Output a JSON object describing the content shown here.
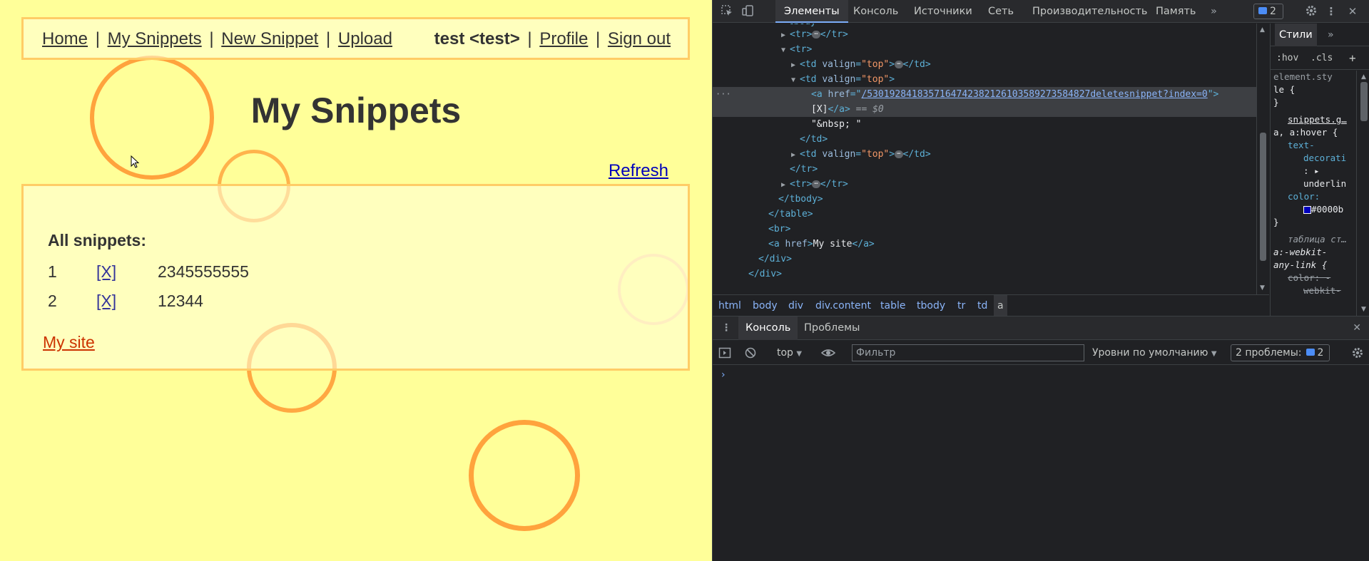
{
  "nav": {
    "home": "Home",
    "my_snippets": "My Snippets",
    "new_snippet": "New Snippet",
    "upload": "Upload",
    "separator": "|",
    "user": "test <test>",
    "profile": "Profile",
    "sign_out": "Sign out"
  },
  "page": {
    "title": "My Snippets",
    "refresh": "Refresh",
    "all_snippets": "All snippets:",
    "my_site": "My site",
    "snippets": [
      {
        "index": "1",
        "delete": "[X]",
        "text": "2345555555"
      },
      {
        "index": "2",
        "delete": "[X]",
        "text": "12344"
      }
    ]
  },
  "devtools": {
    "tabs": [
      "Элементы",
      "Консоль",
      "Источники",
      "Сеть",
      "Производительность",
      "Память"
    ],
    "more": "»",
    "issues_badge": "2",
    "dom": {
      "tag_tr": "tr",
      "tag_td": "td",
      "tag_a": "a",
      "tag_tbody": "tbody",
      "tag_table": "table",
      "tag_br": "br",
      "tag_div": "div",
      "attr_valign": "valign",
      "val_top": "\"top\"",
      "attr_href": "href",
      "selected_href": "/5301928418357164742382126103589273584827deletesnippet?index=0",
      "selected_text": "[X]",
      "selected_suffix": " == $0",
      "nbsp_text": "\"&nbsp; \"",
      "mysite_text": "My site",
      "ellipsis": "⋯"
    },
    "breadcrumbs": [
      "html",
      "body",
      "div",
      "div.content",
      "table",
      "tbody",
      "tr",
      "td",
      "a"
    ],
    "styles": {
      "tab": "Стили",
      "more": "»",
      "hov": ":hov",
      "cls": ".cls",
      "plus": "+",
      "element_style": "element.sty",
      "element_style2": "le {",
      "close": "}",
      "rule1_origin": "snippets.g…",
      "rule1_selector": "a, a:hover {",
      "rule1_prop1": "text-",
      "rule1_prop1b": "decorati",
      "rule1_prop1c": "underlin",
      "rule1_prop2": "color:",
      "rule1_val2": "#0000b",
      "rule2_origin": "таблица ст…",
      "rule2_selector": "a:-webkit-",
      "rule2_selector2": "any-link {",
      "rule2_prop": "color: -",
      "rule2_val": "webkit-"
    },
    "drawer": {
      "tab_console": "Консоль",
      "tab_problems": "Проблемы",
      "context": "top",
      "filter_placeholder": "Фильтр",
      "levels": "Уровни по умолчанию",
      "issues": "2 проблемы:",
      "issues_count": "2",
      "prompt": "›"
    }
  }
}
